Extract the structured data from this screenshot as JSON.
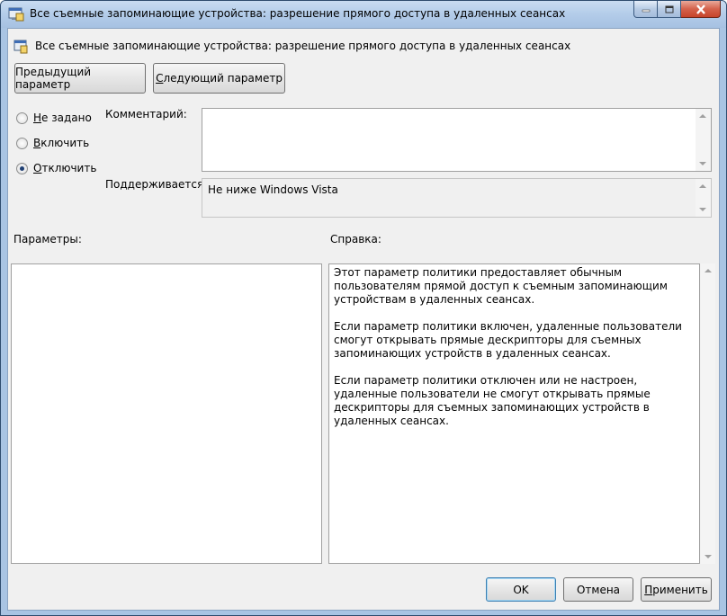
{
  "window": {
    "title": "Все съемные запоминающие устройства: разрешение прямого доступа в удаленных сеансах"
  },
  "header": {
    "policy_name": "Все съемные запоминающие устройства: разрешение прямого доступа в удаленных сеансах"
  },
  "nav": {
    "prev_pre": "Пре",
    "prev_ul": "д",
    "prev_post": "ыдущий параметр",
    "next_ul": "С",
    "next_post": "ледующий параметр"
  },
  "state": {
    "options": [
      {
        "ul": "Н",
        "rest": "е задано",
        "checked": false
      },
      {
        "ul": "В",
        "rest": "ключить",
        "checked": false
      },
      {
        "ul": "О",
        "rest": "тключить",
        "checked": true
      }
    ]
  },
  "comment": {
    "label": "Комментарий:",
    "value": ""
  },
  "supported": {
    "label": "Поддерживается:",
    "value": "Не ниже Windows Vista"
  },
  "params": {
    "label": "Параметры:"
  },
  "help": {
    "label": "Справка:",
    "paragraphs": [
      "Этот параметр политики предоставляет обычным пользователям прямой доступ к съемным запоминающим устройствам в удаленных сеансах.",
      "Если параметр политики включен, удаленные пользователи смогут открывать прямые дескрипторы для съемных запоминающих устройств в удаленных сеансах.",
      "Если параметр политики отключен или не настроен, удаленные пользователи не смогут открывать прямые дескрипторы для съемных запоминающих устройств в удаленных сеансах."
    ]
  },
  "footer": {
    "ok": "OK",
    "cancel": "Отмена",
    "apply_ul": "П",
    "apply_rest": "рименить"
  }
}
